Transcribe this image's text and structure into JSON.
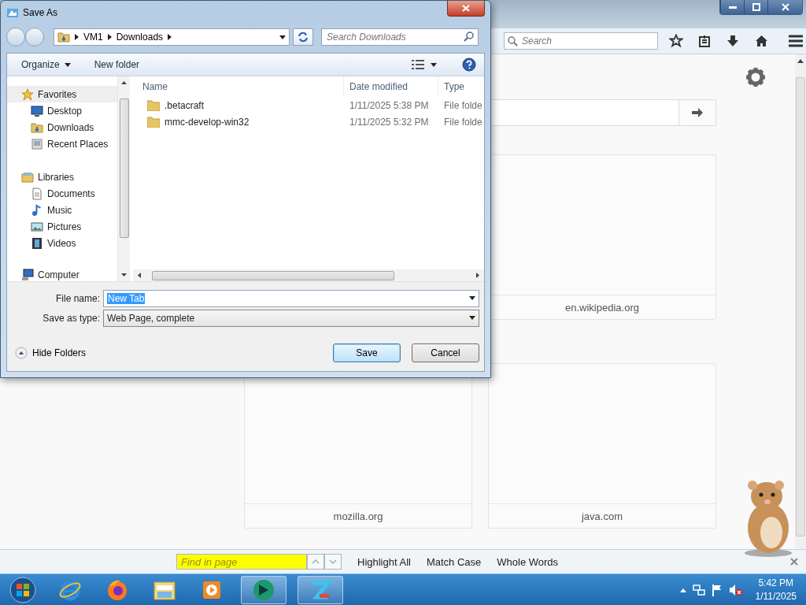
{
  "dialog": {
    "title": "Save As",
    "breadcrumb": [
      "VM1",
      "Downloads"
    ],
    "search": {
      "placeholder": "Search Downloads"
    },
    "commands": [
      "Organize",
      "New folder"
    ],
    "nav": [
      {
        "label": "Favorites",
        "kind": "star",
        "selected": true,
        "children": [
          {
            "label": "Desktop",
            "kind": "desktop",
            "selected": false
          },
          {
            "label": "Downloads",
            "kind": "downloads",
            "selected": false
          },
          {
            "label": "Recent Places",
            "kind": "recent",
            "selected": false
          }
        ]
      },
      {
        "label": "Libraries",
        "kind": "library",
        "selected": false,
        "children": [
          {
            "label": "Documents",
            "kind": "document",
            "selected": false
          },
          {
            "label": "Music",
            "kind": "music",
            "selected": false
          },
          {
            "label": "Pictures",
            "kind": "picture",
            "selected": false
          },
          {
            "label": "Videos",
            "kind": "video",
            "selected": false
          }
        ]
      },
      {
        "label": "Computer",
        "kind": "computer",
        "selected": false
      }
    ],
    "columns": [
      "Name",
      "Date modified",
      "Type"
    ],
    "files": [
      {
        "name": ".betacraft",
        "date": "1/11/2025 5:38 PM",
        "type": "File folde"
      },
      {
        "name": "mmc-develop-win32",
        "date": "1/11/2025 5:32 PM",
        "type": "File folde"
      }
    ],
    "file_name": {
      "label": "File name:",
      "value": "New Tab"
    },
    "save_as_type": {
      "label": "Save as type:",
      "value": "Web Page, complete"
    },
    "hide_folders": "Hide Folders",
    "buttons": [
      {
        "label": "Save",
        "default": true
      },
      {
        "label": "Cancel",
        "default": false
      }
    ]
  },
  "browser": {
    "search": {
      "placeholder": "Search"
    },
    "tiles": [
      {
        "label": "en.wikipedia.org"
      },
      {
        "label": "mozilla.org"
      },
      {
        "label": "java.com"
      }
    ]
  },
  "find_bar": {
    "placeholder": "Find in page",
    "options": [
      "Highlight All",
      "Match Case",
      "Whole Words"
    ]
  },
  "taskbar": {
    "items": [
      {
        "kind": "ie",
        "open": false
      },
      {
        "kind": "firefox",
        "open": false
      },
      {
        "kind": "explorer",
        "open": false
      },
      {
        "kind": "player",
        "open": false
      },
      {
        "kind": "app-green",
        "open": true
      },
      {
        "kind": "app-blue",
        "open": true
      }
    ],
    "clock": {
      "time": "5:42 PM",
      "date": "1/11/2025"
    }
  }
}
